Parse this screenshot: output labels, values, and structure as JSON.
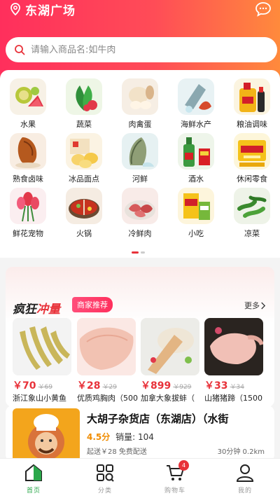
{
  "header": {
    "location": "东湖广场",
    "search_placeholder": "请输入商品名:如牛肉",
    "accent_gradient": [
      "#ff2f5c",
      "#ff8a3c"
    ]
  },
  "categories": [
    {
      "label": "水果",
      "icon": "fruit-icon"
    },
    {
      "label": "蔬菜",
      "icon": "vegetable-icon"
    },
    {
      "label": "肉禽蛋",
      "icon": "meat-egg-icon"
    },
    {
      "label": "海鲜水产",
      "icon": "seafood-icon"
    },
    {
      "label": "粮油调味",
      "icon": "grain-oil-icon"
    },
    {
      "label": "熟食卤味",
      "icon": "deli-icon"
    },
    {
      "label": "冰品面点",
      "icon": "frozen-pastry-icon"
    },
    {
      "label": "河鲜",
      "icon": "river-fish-icon"
    },
    {
      "label": "酒水",
      "icon": "drinks-icon"
    },
    {
      "label": "休闲零食",
      "icon": "snacks-icon"
    },
    {
      "label": "鲜花宠物",
      "icon": "flower-pet-icon"
    },
    {
      "label": "火锅",
      "icon": "hotpot-icon"
    },
    {
      "label": "冷鲜肉",
      "icon": "chilled-meat-icon"
    },
    {
      "label": "小吃",
      "icon": "snack-food-icon"
    },
    {
      "label": "凉菜",
      "icon": "cold-dish-icon"
    }
  ],
  "carousel": {
    "pages": 2,
    "active": 1
  },
  "promo": {
    "title_a": "疯狂",
    "title_b": "冲量",
    "badge": "商家推荐",
    "more": "更多"
  },
  "products": [
    {
      "price": "￥70",
      "old": "￥69",
      "name": "浙江象山小黄鱼"
    },
    {
      "price": "￥28",
      "old": "￥29",
      "name": "优质鸡胸肉（500"
    },
    {
      "price": "￥899",
      "old": "￥929",
      "name": "加拿大象拔蚌（"
    },
    {
      "price": "￥33",
      "old": "￥34",
      "name": "山猪猪蹄（1500"
    }
  ],
  "store": {
    "name": "大胡子杂货店（东湖店）（水街",
    "score": "4.5分",
    "sales": "销量: 104",
    "fee": "起送￥28 免费配送",
    "distance": "30分钟 0.2km"
  },
  "tabbar": [
    {
      "label": "首页",
      "icon": "home-icon",
      "active": true
    },
    {
      "label": "分类",
      "icon": "category-icon",
      "active": false
    },
    {
      "label": "购物车",
      "icon": "cart-icon",
      "active": false
    },
    {
      "label": "我的",
      "icon": "user-icon",
      "active": false
    }
  ],
  "cart_count": "4"
}
